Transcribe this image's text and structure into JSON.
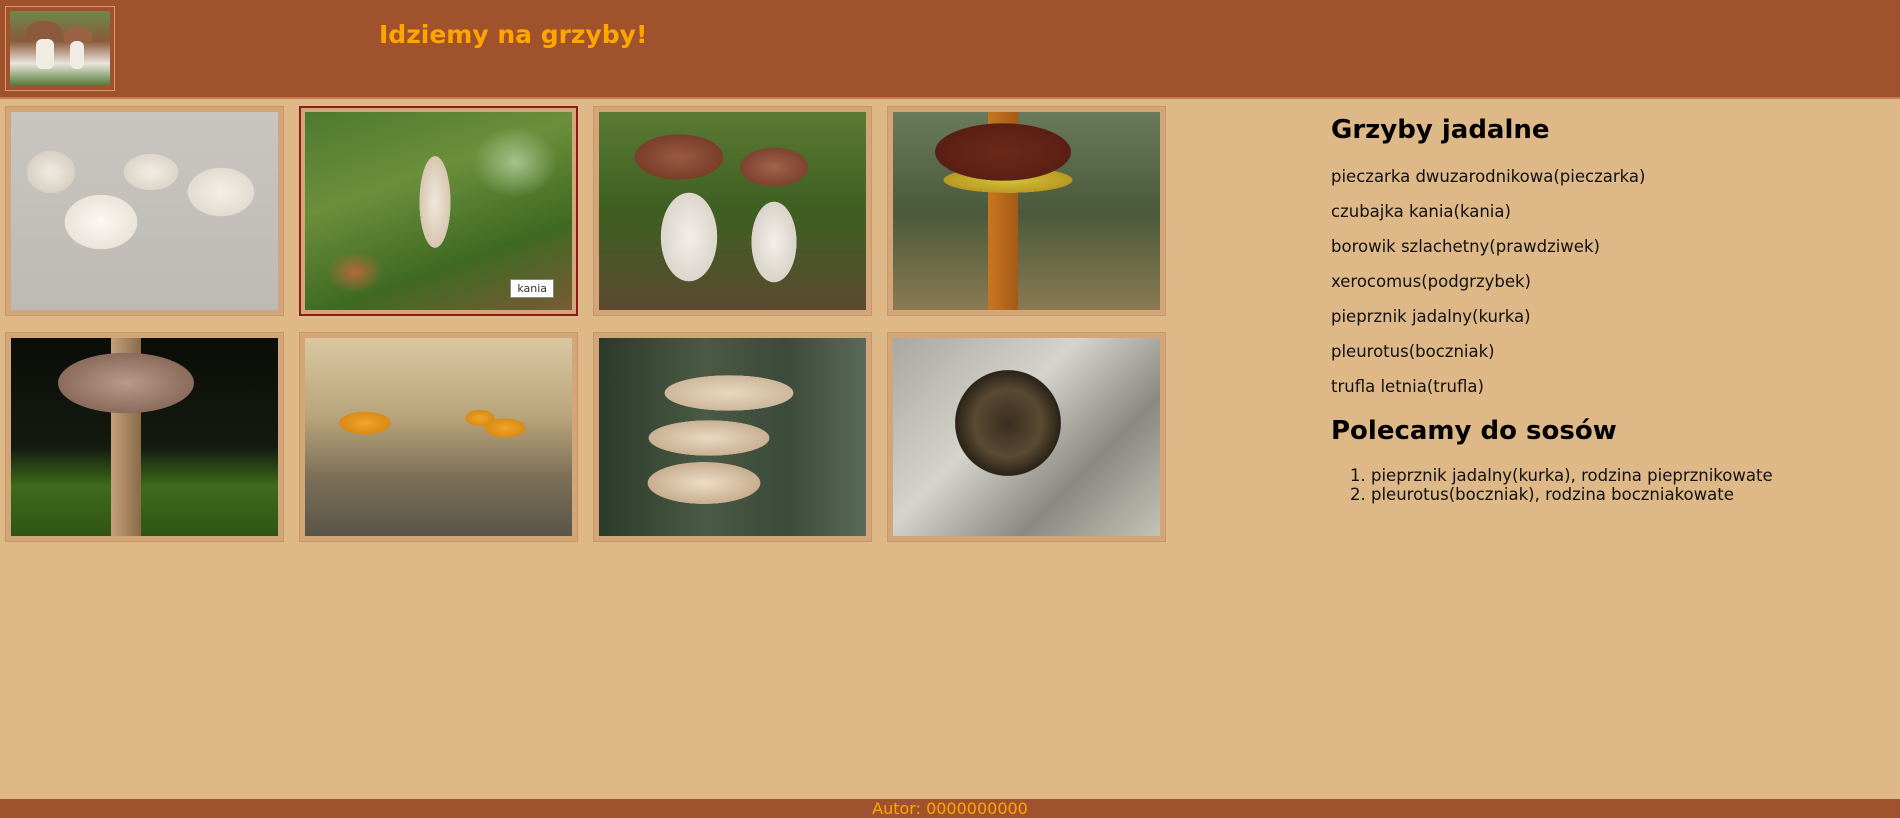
{
  "header": {
    "title": "Idziemy na grzyby!",
    "logo_alt": "grzyby"
  },
  "gallery": [
    {
      "name": "pieczarka",
      "tooltip": ""
    },
    {
      "name": "kania",
      "tooltip": "kania"
    },
    {
      "name": "prawdziwek",
      "tooltip": ""
    },
    {
      "name": "podgrzybek",
      "tooltip": ""
    },
    {
      "name": "gąska",
      "tooltip": ""
    },
    {
      "name": "kurka",
      "tooltip": ""
    },
    {
      "name": "boczniak",
      "tooltip": ""
    },
    {
      "name": "trufla",
      "tooltip": ""
    }
  ],
  "aside": {
    "edible_heading": "Grzyby jadalne",
    "edible": [
      "pieczarka dwuzarodnikowa(pieczarka)",
      "czubajka kania(kania)",
      "borowik szlachetny(prawdziwek)",
      "xerocomus(podgrzybek)",
      "pieprznik jadalny(kurka)",
      "pleurotus(boczniak)",
      "trufla letnia(trufla)"
    ],
    "sauces_heading": "Polecamy do sosów",
    "sauces": [
      "pieprznik jadalny(kurka), rodzina pieprznikowate",
      "pleurotus(boczniak), rodzina boczniakowate"
    ]
  },
  "footer": {
    "author": "Autor: 0000000000"
  },
  "colors": {
    "header_bg": "#A0522D",
    "page_bg": "#DEB887",
    "title": "#FFA500"
  }
}
